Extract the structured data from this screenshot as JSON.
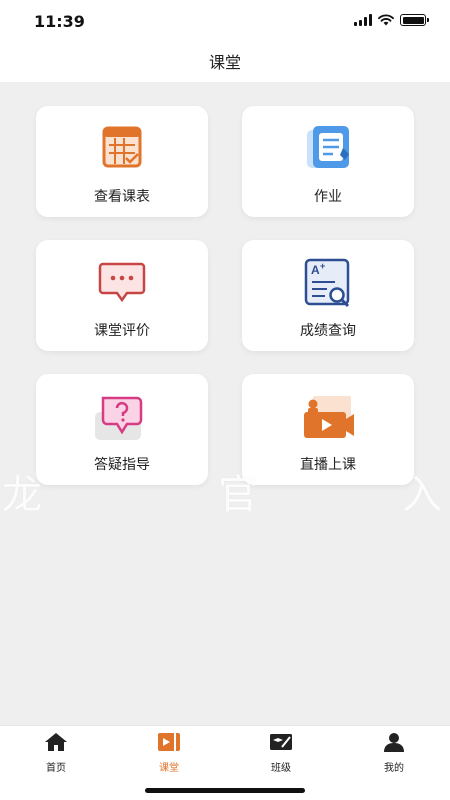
{
  "status_bar": {
    "time": "11:39"
  },
  "nav": {
    "title": "课堂"
  },
  "cards": [
    {
      "label": "查看课表",
      "icon": "schedule-icon"
    },
    {
      "label": "作业",
      "icon": "homework-icon"
    },
    {
      "label": "课堂评价",
      "icon": "comment-icon"
    },
    {
      "label": "成绩查询",
      "icon": "grade-search-icon"
    },
    {
      "label": "答疑指导",
      "icon": "qa-icon"
    },
    {
      "label": "直播上课",
      "icon": "live-class-icon"
    }
  ],
  "watermark": {
    "part1": "龙",
    "part2": "官",
    "part3": "入"
  },
  "tab_bar": {
    "items": [
      {
        "label": "首页",
        "icon": "home-icon"
      },
      {
        "label": "课堂",
        "icon": "classroom-icon",
        "active": true
      },
      {
        "label": "班级",
        "icon": "class-icon"
      },
      {
        "label": "我的",
        "icon": "profile-icon"
      }
    ]
  },
  "colors": {
    "accent": "#e0742a",
    "background": "#efefef"
  }
}
